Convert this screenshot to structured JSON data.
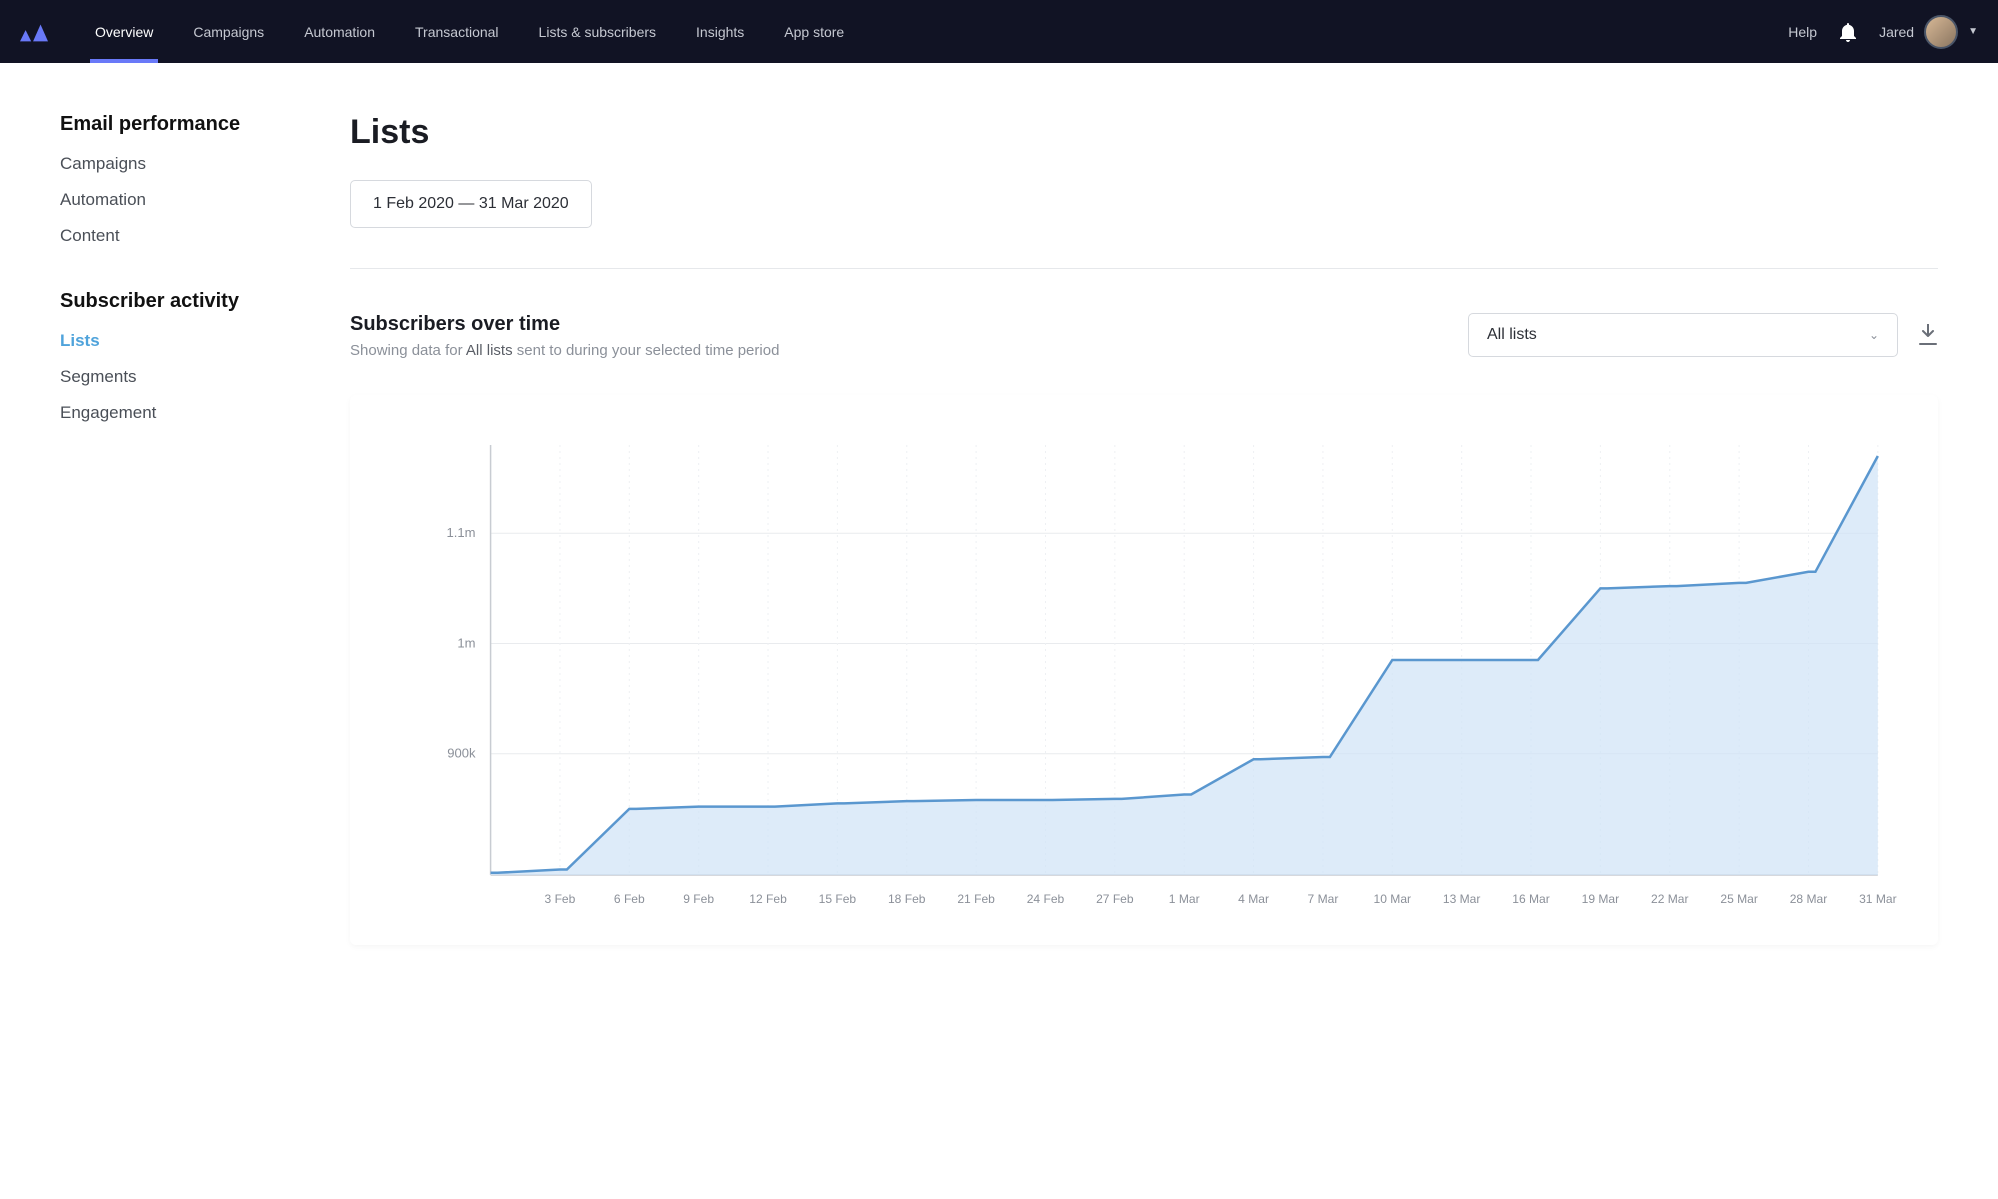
{
  "header": {
    "nav": [
      {
        "label": "Overview",
        "active": true
      },
      {
        "label": "Campaigns",
        "active": false
      },
      {
        "label": "Automation",
        "active": false
      },
      {
        "label": "Transactional",
        "active": false
      },
      {
        "label": "Lists & subscribers",
        "active": false
      },
      {
        "label": "Insights",
        "active": false
      },
      {
        "label": "App store",
        "active": false
      }
    ],
    "help_label": "Help",
    "user_name": "Jared"
  },
  "sidebar": {
    "group1_title": "Email performance",
    "group1_items": [
      "Campaigns",
      "Automation",
      "Content"
    ],
    "group2_title": "Subscriber activity",
    "group2_items": [
      "Lists",
      "Segments",
      "Engagement"
    ],
    "active_item": "Lists"
  },
  "page": {
    "title": "Lists",
    "date_range": "1 Feb 2020 — 31 Mar 2020",
    "section_title": "Subscribers over time",
    "section_sub_prefix": "Showing data for ",
    "section_sub_emph": "All lists",
    "section_sub_suffix": " sent to during your selected time period",
    "list_filter": "All lists"
  },
  "chart_data": {
    "type": "area",
    "title": "Subscribers over time",
    "xlabel": "",
    "ylabel": "",
    "ylim": [
      790000,
      1180000
    ],
    "y_ticks": [
      900000,
      1000000,
      1100000
    ],
    "y_tick_labels": [
      "900k",
      "1m",
      "1.1m"
    ],
    "x_tick_labels": [
      "3 Feb",
      "6 Feb",
      "9 Feb",
      "12 Feb",
      "15 Feb",
      "18 Feb",
      "21 Feb",
      "24 Feb",
      "27 Feb",
      "1 Mar",
      "4 Mar",
      "7 Mar",
      "10 Mar",
      "13 Mar",
      "16 Mar",
      "19 Mar",
      "22 Mar",
      "25 Mar",
      "28 Mar",
      "31 Mar"
    ],
    "x": [
      "1 Feb",
      "3 Feb",
      "6 Feb",
      "9 Feb",
      "12 Feb",
      "15 Feb",
      "18 Feb",
      "21 Feb",
      "24 Feb",
      "27 Feb",
      "1 Mar",
      "4 Mar",
      "7 Mar",
      "10 Mar",
      "13 Mar",
      "16 Mar",
      "19 Mar",
      "22 Mar",
      "25 Mar",
      "28 Mar",
      "31 Mar"
    ],
    "values": [
      792000,
      795000,
      850000,
      852000,
      852000,
      855000,
      857000,
      858000,
      858000,
      859000,
      863000,
      895000,
      897000,
      985000,
      985000,
      985000,
      1050000,
      1052000,
      1055000,
      1065000,
      1170000
    ]
  }
}
